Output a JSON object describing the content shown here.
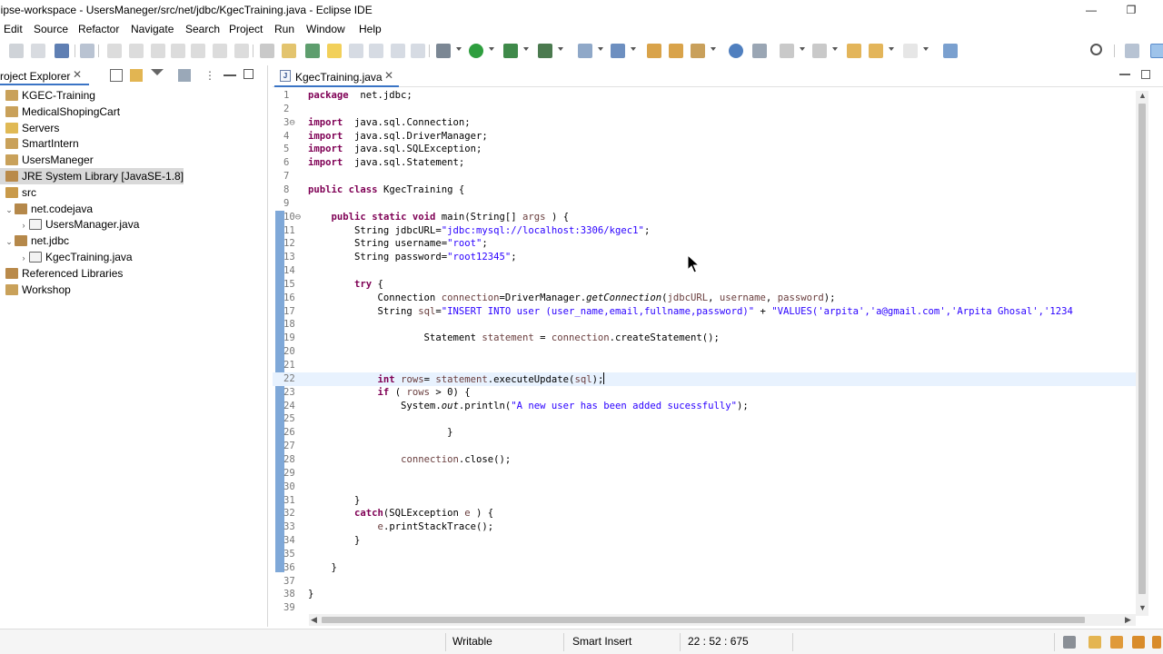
{
  "window": {
    "title": "lipse-workspace - UsersManeger/src/net/jdbc/KgecTraining.java - Eclipse IDE",
    "minimize_glyph": "—",
    "restore_glyph": "❐"
  },
  "menu": [
    "Edit",
    "Source",
    "Refactor",
    "Navigate",
    "Search",
    "Project",
    "Run",
    "Window",
    "Help"
  ],
  "project_explorer": {
    "tab_label": "roject Explorer",
    "close_glyph": "✕",
    "tree": [
      {
        "label": "KGEC-Training",
        "indent": 0,
        "icon": "project-icon"
      },
      {
        "label": "MedicalShopingCart",
        "indent": 0,
        "icon": "project-icon"
      },
      {
        "label": "Servers",
        "indent": 0,
        "icon": "folder-icon"
      },
      {
        "label": "SmartIntern",
        "indent": 0,
        "icon": "project-icon"
      },
      {
        "label": "UsersManeger",
        "indent": 0,
        "icon": "project-icon"
      },
      {
        "label": "JRE System Library [JavaSE-1.8]",
        "indent": 0,
        "icon": "library-icon",
        "selected": true
      },
      {
        "label": "src",
        "indent": 0,
        "icon": "source-folder-icon"
      },
      {
        "label": "net.codejava",
        "indent": 1,
        "icon": "package-icon",
        "twisty": "expanded"
      },
      {
        "label": "UsersManager.java",
        "indent": 2,
        "icon": "java-file-icon",
        "twisty": "collapsed"
      },
      {
        "label": "net.jdbc",
        "indent": 1,
        "icon": "package-icon",
        "twisty": "expanded"
      },
      {
        "label": "KgecTraining.java",
        "indent": 2,
        "icon": "java-file-icon",
        "twisty": "collapsed"
      },
      {
        "label": "Referenced Libraries",
        "indent": 0,
        "icon": "library-icon"
      },
      {
        "label": "Workshop",
        "indent": 0,
        "icon": "project-icon"
      }
    ]
  },
  "editor": {
    "tab_label": "KgecTraining.java",
    "tab_icon_glyph": "J",
    "close_glyph": "✕",
    "current_line": 22,
    "lines": [
      {
        "n": "1",
        "parts": [
          [
            "kw",
            "package"
          ],
          [
            "",
            "  net.jdbc;"
          ]
        ]
      },
      {
        "n": "2",
        "parts": []
      },
      {
        "n": "3⊖",
        "parts": [
          [
            "kw",
            "import"
          ],
          [
            "",
            "  java.sql.Connection;"
          ]
        ]
      },
      {
        "n": "4",
        "parts": [
          [
            "kw",
            "import"
          ],
          [
            "",
            "  java.sql.DriverManager;"
          ]
        ]
      },
      {
        "n": "5",
        "parts": [
          [
            "kw",
            "import"
          ],
          [
            "",
            "  java.sql.SQLException;"
          ]
        ]
      },
      {
        "n": "6",
        "parts": [
          [
            "kw",
            "import"
          ],
          [
            "",
            "  java.sql.Statement;"
          ]
        ]
      },
      {
        "n": "7",
        "parts": []
      },
      {
        "n": "8",
        "parts": [
          [
            "kw",
            "public"
          ],
          [
            "",
            " "
          ],
          [
            "kw",
            "class"
          ],
          [
            "",
            " KgecTraining {"
          ]
        ]
      },
      {
        "n": "9",
        "parts": []
      },
      {
        "n": "10⊖",
        "parts": [
          [
            "",
            "    "
          ],
          [
            "kw",
            "public"
          ],
          [
            "",
            " "
          ],
          [
            "kw",
            "static"
          ],
          [
            "",
            " "
          ],
          [
            "kw",
            "void"
          ],
          [
            "",
            " main(String[] "
          ],
          [
            "var",
            "args"
          ],
          [
            "",
            " ) {"
          ]
        ]
      },
      {
        "n": "11",
        "parts": [
          [
            "",
            "        String jdbcURL="
          ],
          [
            "str",
            "\"jdbc:mysql://localhost:3306/kgec1\""
          ],
          [
            "",
            ";"
          ]
        ]
      },
      {
        "n": "12",
        "parts": [
          [
            "",
            "        String username="
          ],
          [
            "str",
            "\"root\""
          ],
          [
            "",
            ";"
          ]
        ]
      },
      {
        "n": "13",
        "parts": [
          [
            "",
            "        String password="
          ],
          [
            "str",
            "\"root12345\""
          ],
          [
            "",
            ";"
          ]
        ]
      },
      {
        "n": "14",
        "parts": []
      },
      {
        "n": "15",
        "parts": [
          [
            "",
            "        "
          ],
          [
            "kw",
            "try"
          ],
          [
            "",
            " {"
          ]
        ]
      },
      {
        "n": "16",
        "parts": [
          [
            "",
            "            Connection "
          ],
          [
            "var",
            "connection"
          ],
          [
            "",
            "=DriverManager."
          ],
          [
            "it",
            "getConnection"
          ],
          [
            "",
            "("
          ],
          [
            "var",
            "jdbcURL"
          ],
          [
            "",
            ", "
          ],
          [
            "var",
            "username"
          ],
          [
            "",
            ", "
          ],
          [
            "var",
            "password"
          ],
          [
            "",
            ");"
          ]
        ]
      },
      {
        "n": "17",
        "parts": [
          [
            "",
            "            String "
          ],
          [
            "var",
            "sql"
          ],
          [
            "",
            "="
          ],
          [
            "str",
            "\"INSERT INTO user (user_name,email,fullname,password)\""
          ],
          [
            "",
            " + "
          ],
          [
            "str",
            "\"VALUES('arpita','a@gmail.com','Arpita Ghosal','1234"
          ]
        ]
      },
      {
        "n": "18",
        "parts": []
      },
      {
        "n": "19",
        "parts": [
          [
            "",
            "                    Statement "
          ],
          [
            "var",
            "statement"
          ],
          [
            "",
            " = "
          ],
          [
            "var",
            "connection"
          ],
          [
            "",
            ".createStatement();"
          ]
        ]
      },
      {
        "n": "20",
        "parts": []
      },
      {
        "n": "21",
        "parts": []
      },
      {
        "n": "22",
        "parts": [
          [
            "",
            "            "
          ],
          [
            "kw",
            "int"
          ],
          [
            "",
            " "
          ],
          [
            "var",
            "rows"
          ],
          [
            "",
            "= "
          ],
          [
            "var",
            "statement"
          ],
          [
            "",
            ".executeUpdate("
          ],
          [
            "var",
            "sql"
          ],
          [
            "",
            ");"
          ]
        ],
        "caret": true
      },
      {
        "n": "23",
        "parts": [
          [
            "",
            "            "
          ],
          [
            "kw",
            "if"
          ],
          [
            "",
            " ( "
          ],
          [
            "var",
            "rows"
          ],
          [
            "",
            " > 0) {"
          ]
        ]
      },
      {
        "n": "24",
        "parts": [
          [
            "",
            "                System."
          ],
          [
            "it",
            "out"
          ],
          [
            "",
            ".println("
          ],
          [
            "str",
            "\"A new user has been added sucessfully\""
          ],
          [
            "",
            ");"
          ]
        ]
      },
      {
        "n": "25",
        "parts": []
      },
      {
        "n": "26",
        "parts": [
          [
            "",
            "                        }"
          ]
        ]
      },
      {
        "n": "27",
        "parts": []
      },
      {
        "n": "28",
        "parts": [
          [
            "",
            "                "
          ],
          [
            "var",
            "connection"
          ],
          [
            "",
            ".close();"
          ]
        ]
      },
      {
        "n": "29",
        "parts": []
      },
      {
        "n": "30",
        "parts": []
      },
      {
        "n": "31",
        "parts": [
          [
            "",
            "        }"
          ]
        ]
      },
      {
        "n": "32",
        "parts": [
          [
            "",
            "        "
          ],
          [
            "kw",
            "catch"
          ],
          [
            "",
            "(SQLException "
          ],
          [
            "var",
            "e"
          ],
          [
            "",
            " ) {"
          ]
        ]
      },
      {
        "n": "33",
        "parts": [
          [
            "",
            "            "
          ],
          [
            "var",
            "e"
          ],
          [
            "",
            ".printStackTrace();"
          ]
        ]
      },
      {
        "n": "34",
        "parts": [
          [
            "",
            "        }"
          ]
        ]
      },
      {
        "n": "35",
        "parts": []
      },
      {
        "n": "36",
        "parts": [
          [
            "",
            "    }"
          ]
        ]
      },
      {
        "n": "37",
        "parts": []
      },
      {
        "n": "38",
        "parts": [
          [
            "",
            "}"
          ]
        ]
      },
      {
        "n": "39",
        "parts": []
      }
    ]
  },
  "status": {
    "writable": "Writable",
    "insert_mode": "Smart Insert",
    "position": "22 : 52 : 675"
  },
  "colors": {
    "keyword": "#7f0055",
    "string": "#2a00ff",
    "variable": "#6a3e3e",
    "selection": "#3a74c5",
    "current_line": "#e8f2fe"
  }
}
